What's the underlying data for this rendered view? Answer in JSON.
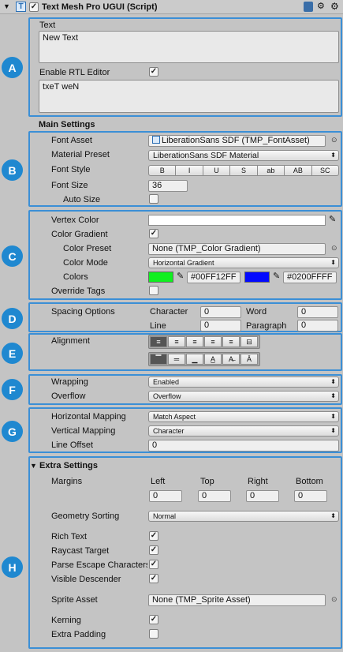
{
  "header": {
    "title": "Text Mesh Pro UGUI (Script)",
    "icon_label": "T"
  },
  "badges": [
    "A",
    "B",
    "C",
    "D",
    "E",
    "F",
    "G",
    "H"
  ],
  "text_section": {
    "text_label": "Text",
    "text_value": "New Text",
    "rtl_label": "Enable RTL Editor",
    "rtl_value": "txeT weN"
  },
  "main_settings": "Main Settings",
  "font": {
    "asset_label": "Font Asset",
    "asset_value": "LiberationSans SDF (TMP_FontAsset)",
    "material_label": "Material Preset",
    "material_value": "LiberationSans SDF Material",
    "style_label": "Font Style",
    "styles": [
      "B",
      "I",
      "U",
      "S",
      "ab",
      "AB",
      "SC"
    ],
    "size_label": "Font Size",
    "size_value": "36",
    "autosize_label": "Auto Size"
  },
  "color": {
    "vertex_label": "Vertex Color",
    "gradient_label": "Color Gradient",
    "preset_label": "Color Preset",
    "preset_value": "None (TMP_Color Gradient)",
    "mode_label": "Color Mode",
    "mode_value": "Horizontal Gradient",
    "colors_label": "Colors",
    "color1": "#00FF12FF",
    "color2": "#0200FFFF",
    "swatch1": "#10f020",
    "swatch2": "#0209ff",
    "override_label": "Override Tags"
  },
  "spacing": {
    "label": "Spacing Options",
    "character_label": "Character",
    "character_value": "0",
    "word_label": "Word",
    "word_value": "0",
    "line_label": "Line",
    "line_value": "0",
    "paragraph_label": "Paragraph",
    "paragraph_value": "0"
  },
  "alignment": {
    "label": "Alignment",
    "h_icons": [
      "align-left-icon",
      "align-center-icon",
      "align-right-icon",
      "align-justified-icon",
      "align-flush-icon",
      "align-geometry-center-icon"
    ],
    "v_icons": [
      "align-top-icon",
      "align-middle-icon",
      "align-bottom-icon",
      "align-baseline-icon",
      "align-midline-icon",
      "align-capline-icon"
    ]
  },
  "wrapping": {
    "wrap_label": "Wrapping",
    "wrap_value": "Enabled",
    "overflow_label": "Overflow",
    "overflow_value": "Overflow"
  },
  "mapping": {
    "h_label": "Horizontal Mapping",
    "h_value": "Match Aspect",
    "v_label": "Vertical Mapping",
    "v_value": "Character",
    "offset_label": "Line Offset",
    "offset_value": "0"
  },
  "extra": {
    "title": "Extra Settings",
    "margins_label": "Margins",
    "left_label": "Left",
    "top_label": "Top",
    "right_label": "Right",
    "bottom_label": "Bottom",
    "left": "0",
    "top": "0",
    "right": "0",
    "bottom": "0",
    "sorting_label": "Geometry Sorting",
    "sorting_value": "Normal",
    "rich_label": "Rich Text",
    "raycast_label": "Raycast Target",
    "escape_label": "Parse Escape Characters",
    "visible_label": "Visible Descender",
    "sprite_label": "Sprite Asset",
    "sprite_value": "None (TMP_Sprite Asset)",
    "kerning_label": "Kerning",
    "padding_label": "Extra Padding"
  },
  "accent": "#3b8fd6"
}
